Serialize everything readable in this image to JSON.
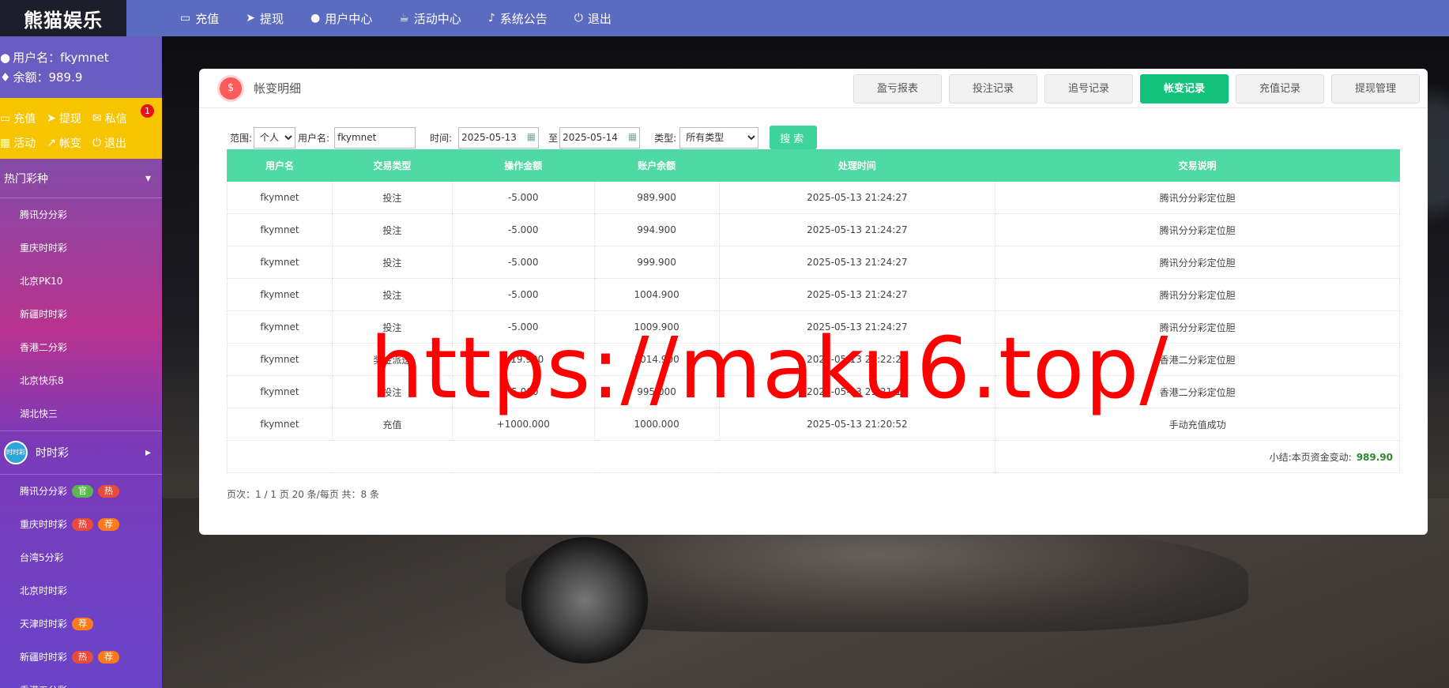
{
  "logo": {
    "text": "熊猫娱乐"
  },
  "nav": [
    {
      "label": "充值",
      "icon": "card-icon"
    },
    {
      "label": "提现",
      "icon": "send-icon"
    },
    {
      "label": "用户中心",
      "icon": "user-icon"
    },
    {
      "label": "活动中心",
      "icon": "cup-icon"
    },
    {
      "label": "系统公告",
      "icon": "bell-icon"
    },
    {
      "label": "退出",
      "icon": "power-icon"
    }
  ],
  "user": {
    "name_line": "用户名：fkymnet",
    "balance_line": "余额：989.9"
  },
  "quick": {
    "row1": [
      "充值",
      "提现",
      "私信"
    ],
    "row2": [
      "活动",
      "帐变",
      "退出"
    ],
    "unread": "1"
  },
  "sidebar": {
    "group1": "热门彩种",
    "group1_items": [
      "腾讯分分彩",
      "重庆时时彩",
      "北京PK10",
      "新疆时时彩",
      "香港二分彩",
      "北京快乐8",
      "湖北快三"
    ],
    "group2_icon": "时时彩",
    "group2": "时时彩",
    "group2_items": [
      {
        "name": "腾讯分分彩",
        "tags": [
          "官",
          "热"
        ]
      },
      {
        "name": "重庆时时彩",
        "tags": [
          "热",
          "荐"
        ]
      },
      {
        "name": "台湾5分彩",
        "tags": []
      },
      {
        "name": "北京时时彩",
        "tags": []
      },
      {
        "name": "天津时时彩",
        "tags": [
          "荐"
        ]
      },
      {
        "name": "新疆时时彩",
        "tags": [
          "热",
          "荐"
        ]
      },
      {
        "name": "香港五分彩",
        "tags": []
      }
    ]
  },
  "panel": {
    "icon": "$",
    "title": "帐变明细",
    "tabs": [
      "盈亏报表",
      "投注记录",
      "追号记录",
      "帐变记录",
      "充值记录",
      "提现管理"
    ],
    "active_tab": "帐变记录"
  },
  "filters": {
    "scope_label": "范围:",
    "scope_value": "个人",
    "user_label": "用户名:",
    "user_value": "fkymnet",
    "time_label": "时间:",
    "date_from": "2025-05-13",
    "to_label": "至",
    "date_to": "2025-05-14",
    "type_label": "类型:",
    "type_value": "所有类型",
    "search_label": "搜索"
  },
  "table": {
    "headers": [
      "用户名",
      "交易类型",
      "操作金额",
      "账户余额",
      "处理时间",
      "交易说明"
    ],
    "rows": [
      {
        "user": "fkymnet",
        "type": "投注",
        "amount": "-5.000",
        "balance": "989.900",
        "time": "2025-05-13 21:24:27",
        "desc": "腾讯分分彩定位胆"
      },
      {
        "user": "fkymnet",
        "type": "投注",
        "amount": "-5.000",
        "balance": "994.900",
        "time": "2025-05-13 21:24:27",
        "desc": "腾讯分分彩定位胆"
      },
      {
        "user": "fkymnet",
        "type": "投注",
        "amount": "-5.000",
        "balance": "999.900",
        "time": "2025-05-13 21:24:27",
        "desc": "腾讯分分彩定位胆"
      },
      {
        "user": "fkymnet",
        "type": "投注",
        "amount": "-5.000",
        "balance": "1004.900",
        "time": "2025-05-13 21:24:27",
        "desc": "腾讯分分彩定位胆"
      },
      {
        "user": "fkymnet",
        "type": "投注",
        "amount": "-5.000",
        "balance": "1009.900",
        "time": "2025-05-13 21:24:27",
        "desc": "腾讯分分彩定位胆"
      },
      {
        "user": "fkymnet",
        "type": "奖金派送",
        "amount": "+19.900",
        "balance": "1014.900",
        "time": "2025-05-13 21:22:29",
        "desc": "香港二分彩定位胆"
      },
      {
        "user": "fkymnet",
        "type": "投注",
        "amount": "-5.000",
        "balance": "995.000",
        "time": "2025-05-13 21:21:16",
        "desc": "香港二分彩定位胆"
      },
      {
        "user": "fkymnet",
        "type": "充值",
        "amount": "+1000.000",
        "balance": "1000.000",
        "time": "2025-05-13 21:20:52",
        "desc": "手动充值成功"
      }
    ],
    "summary_label": "小结:本页资金变动:",
    "summary_value": "989.90"
  },
  "pager": "页次：1 / 1 页 20 条/每页 共：8 条",
  "watermark": "https://maku6.top/",
  "colors": {
    "nav": "#5b6cc0",
    "quickbar": "#f7c500",
    "table_head": "#4fd9a3",
    "active_tab": "#13c27a",
    "negative": "#e33333",
    "positive": "#2bb24c",
    "watermark": "#ff0000"
  }
}
